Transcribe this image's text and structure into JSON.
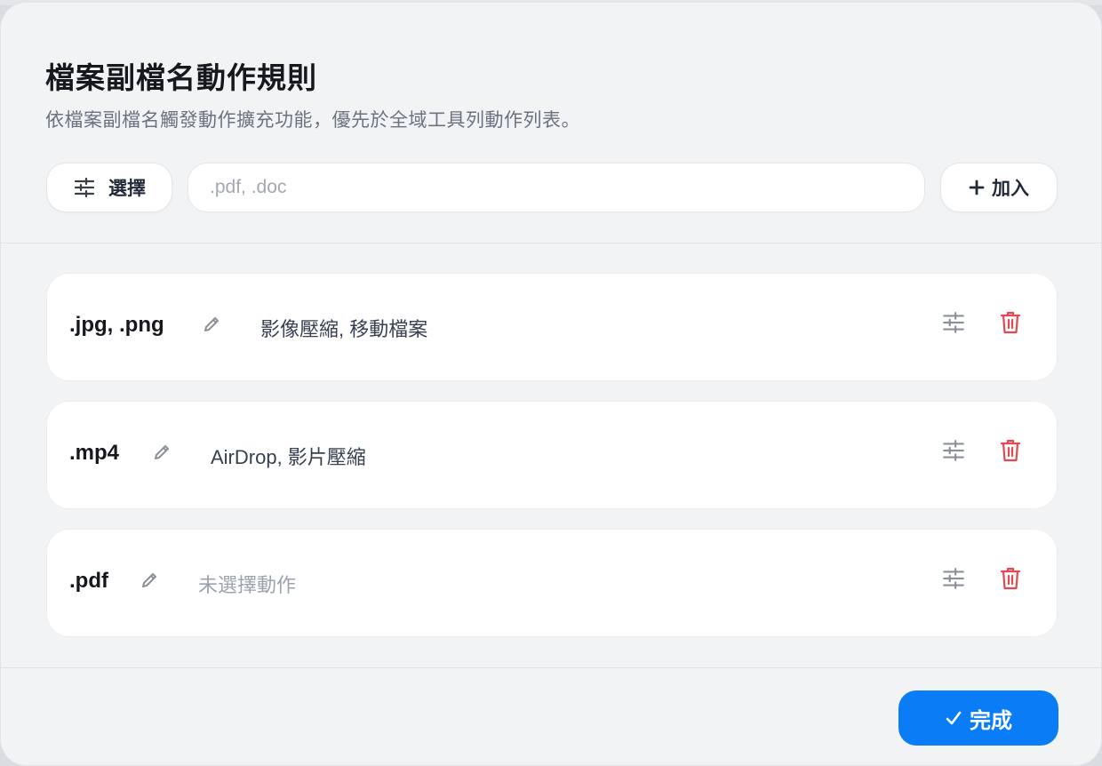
{
  "dialog": {
    "title": "檔案副檔名動作規則",
    "subtitle": "依檔案副檔名觸發動作擴充功能，優先於全域工具列動作列表。"
  },
  "toolbar": {
    "select_label": "選擇",
    "input_value": "",
    "input_placeholder": ".pdf, .doc",
    "add_label": "加入"
  },
  "rules": [
    {
      "extensions": ".jpg, .png",
      "actions": "影像壓縮, 移動檔案"
    },
    {
      "extensions": ".mp4",
      "actions": "AirDrop, 影片壓縮"
    },
    {
      "extensions": ".pdf",
      "actions": "未選擇動作"
    }
  ],
  "footer": {
    "done_label": "完成"
  },
  "icons": {
    "select": "sliders-icon",
    "add": "plus-icon",
    "edit": "pencil-icon",
    "config": "sliders-icon",
    "delete": "trash-icon",
    "done": "checkmark-icon"
  },
  "colors": {
    "accent": "#0a7cf5",
    "danger": "#e5484d",
    "muted_icon": "#8b9099"
  }
}
